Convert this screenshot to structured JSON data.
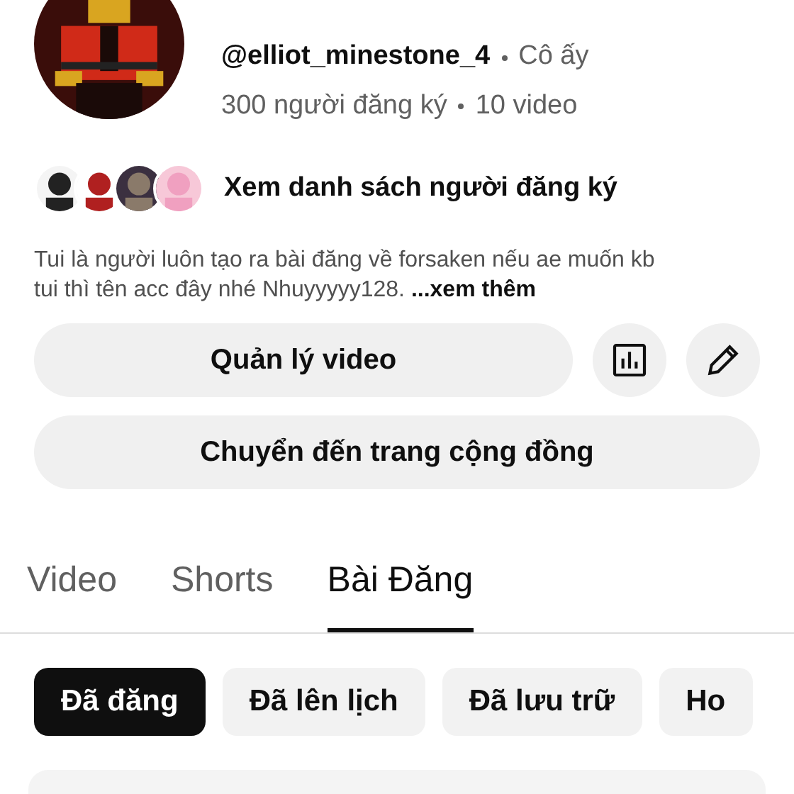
{
  "profile": {
    "handle": "@elliot_minestone_4",
    "pronoun": "Cô ấy",
    "subscribers": "300 người đăng ký",
    "videos": "10 video"
  },
  "subscriber_preview": {
    "label": "Xem danh sách người đăng ký"
  },
  "description": {
    "text": "Tui là người luôn tạo ra bài đăng về forsaken nếu ae muốn kb tui thì tên acc đây nhé Nhuyyyyy128.",
    "more": "...xem thêm"
  },
  "buttons": {
    "manage": "Quản lý video",
    "community": "Chuyển đến trang cộng đồng"
  },
  "tabs": [
    {
      "label": "Video",
      "selected": false
    },
    {
      "label": "Shorts",
      "selected": false
    },
    {
      "label": "Bài Đăng",
      "selected": true
    }
  ],
  "chips": [
    {
      "label": "Đã đăng",
      "selected": true
    },
    {
      "label": "Đã lên lịch",
      "selected": false
    },
    {
      "label": "Đã lưu trữ",
      "selected": false
    },
    {
      "label": "Ho",
      "selected": false
    }
  ]
}
